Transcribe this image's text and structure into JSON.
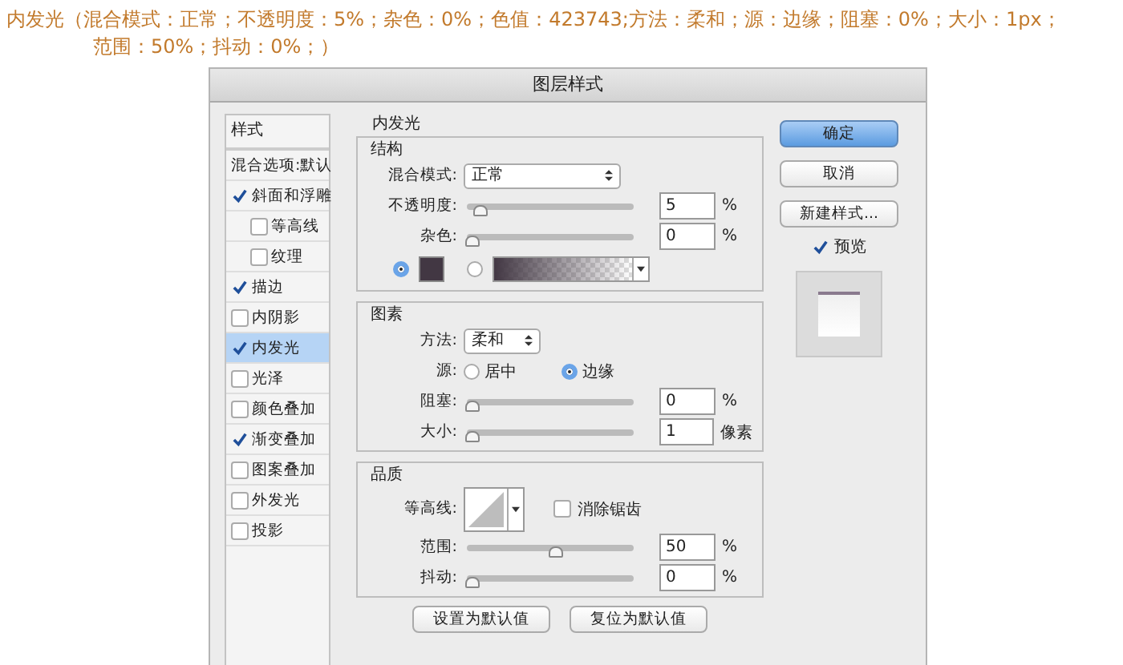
{
  "caption": {
    "line_1": "内发光（混合模式：正常；不透明度：5%；杂色：0%；色值：423743;方法：柔和；源：边缘；阻塞：0%；大小：1px；",
    "line_2": "范围：50%；抖动：0%；）"
  },
  "window": {
    "title": "图层样式"
  },
  "sidebar": {
    "header": "样式",
    "blend_options": "混合选项:默认",
    "items": [
      {
        "label": "斜面和浮雕",
        "checked": true,
        "selected": false,
        "children": [
          {
            "label": "等高线",
            "checked": false,
            "selected": false
          },
          {
            "label": "纹理",
            "checked": false,
            "selected": false
          }
        ]
      },
      {
        "label": "描边",
        "checked": true,
        "selected": false
      },
      {
        "label": "内阴影",
        "checked": false,
        "selected": false
      },
      {
        "label": "内发光",
        "checked": true,
        "selected": true
      },
      {
        "label": "光泽",
        "checked": false,
        "selected": false
      },
      {
        "label": "颜色叠加",
        "checked": false,
        "selected": false
      },
      {
        "label": "渐变叠加",
        "checked": true,
        "selected": false
      },
      {
        "label": "图案叠加",
        "checked": false,
        "selected": false
      },
      {
        "label": "外发光",
        "checked": false,
        "selected": false
      },
      {
        "label": "投影",
        "checked": false,
        "selected": false
      }
    ]
  },
  "panel": {
    "title": "内发光",
    "structure": {
      "title": "结构",
      "blend_mode": {
        "label": "混合模式:",
        "value": "正常"
      },
      "sliders": [
        {
          "label": "不透明度:",
          "level": 0.05,
          "value": "5",
          "unit": "%"
        },
        {
          "label": "杂色:",
          "level": 0,
          "value": "0",
          "unit": "%"
        }
      ],
      "fill": [
        {
          "kind": "swatch",
          "selected": true
        },
        {
          "kind": "gradient",
          "selected": false
        }
      ]
    },
    "elements": {
      "title": "图素",
      "technique": {
        "label": "方法:",
        "value": "柔和"
      },
      "source": {
        "label": "源:",
        "options": [
          {
            "label": "居中",
            "selected": false
          },
          {
            "label": "边缘",
            "selected": true
          }
        ]
      },
      "sliders": [
        {
          "label": "阻塞:",
          "level": 0,
          "value": "0",
          "unit": "%"
        },
        {
          "label": "大小:",
          "level": 0.004,
          "value": "1",
          "unit": "像素"
        }
      ]
    },
    "quality": {
      "title": "品质",
      "contour": {
        "label": "等高线:"
      },
      "anti_alias": {
        "label": "消除锯齿",
        "checked": false
      },
      "sliders": [
        {
          "label": "范围:",
          "level": 0.5,
          "value": "50",
          "unit": "%"
        },
        {
          "label": "抖动:",
          "level": 0,
          "value": "0",
          "unit": "%"
        }
      ]
    },
    "buttons": [
      "设置为默认值",
      "复位为默认值"
    ]
  },
  "actions": [
    {
      "label": "确定",
      "primary": true
    },
    {
      "label": "取消",
      "primary": false
    },
    {
      "label": "新建样式...",
      "primary": false
    }
  ],
  "preview": {
    "label": "预览",
    "checked": true
  }
}
